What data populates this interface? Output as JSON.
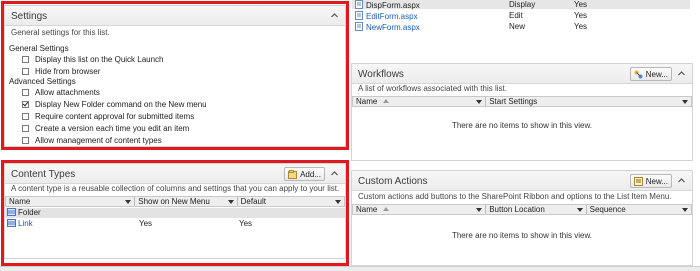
{
  "forms": {
    "rows": [
      {
        "name": "DispForm.aspx",
        "type": "Display",
        "default": "Yes"
      },
      {
        "name": "EditForm.aspx",
        "type": "Edit",
        "default": "Yes"
      },
      {
        "name": "NewForm.aspx",
        "type": "New",
        "default": "Yes"
      }
    ]
  },
  "settings": {
    "title": "Settings",
    "description": "General settings for this list.",
    "general_heading": "General Settings",
    "general_items": [
      {
        "label": "Display this list on the Quick Launch",
        "checked": false
      },
      {
        "label": "Hide from browser",
        "checked": false
      }
    ],
    "advanced_heading": "Advanced Settings",
    "advanced_items": [
      {
        "label": "Allow attachments",
        "checked": false
      },
      {
        "label": "Display New Folder command on the New menu",
        "checked": true
      },
      {
        "label": "Require content approval for submitted items",
        "checked": false
      },
      {
        "label": "Create a version each time you edit an item",
        "checked": false
      },
      {
        "label": "Allow management of content types",
        "checked": false
      }
    ]
  },
  "content_types": {
    "title": "Content Types",
    "add_label": "Add...",
    "description": "A content type is a reusable collection of columns and settings that you can apply to your list.",
    "columns": [
      "Name",
      "Show on New Menu",
      "Default"
    ],
    "rows": [
      {
        "name": "Folder",
        "show": "",
        "default": ""
      },
      {
        "name": "Link",
        "show": "Yes",
        "default": "Yes"
      }
    ]
  },
  "workflows": {
    "title": "Workflows",
    "new_label": "New...",
    "description": "A list of workflows associated with this list.",
    "columns": [
      "Name",
      "Start Settings"
    ],
    "empty": "There are no items to show in this view."
  },
  "custom_actions": {
    "title": "Custom Actions",
    "new_label": "New...",
    "description": "Custom actions add buttons to the SharePoint Ribbon and options to the List Item Menu.",
    "columns": [
      "Name",
      "Button Location",
      "Sequence"
    ],
    "empty": "There are no items to show in this view."
  },
  "colors": {
    "highlight": "#e0191f",
    "link": "#1a5cb5"
  }
}
